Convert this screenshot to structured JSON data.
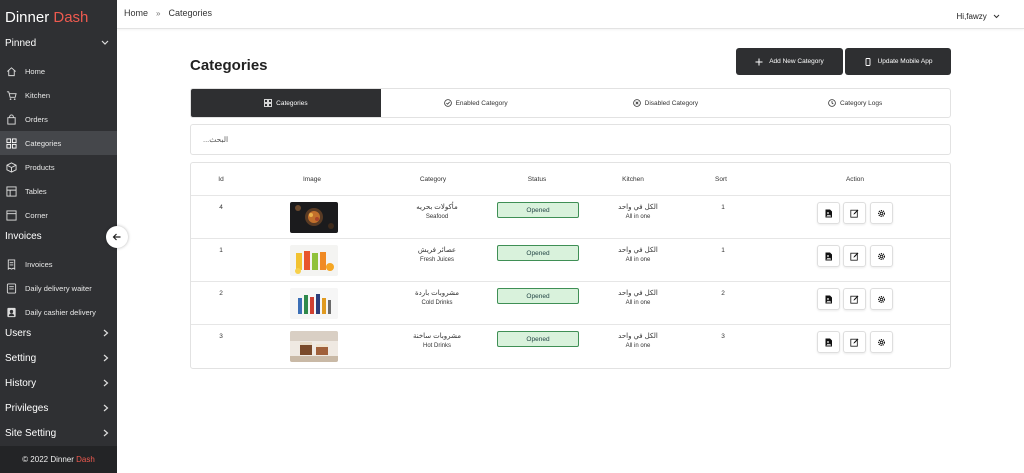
{
  "sidebar": {
    "brand_primary": "Dinner",
    "brand_accent": "Dash",
    "sections": [
      {
        "label": "Pinned",
        "chevron": "v"
      },
      {
        "label": "Invoices",
        "chevron": ""
      },
      {
        "label": "Users",
        "chevron": ">"
      },
      {
        "label": "Setting",
        "chevron": ">"
      },
      {
        "label": "History",
        "chevron": ">"
      },
      {
        "label": "Privileges",
        "chevron": ">"
      },
      {
        "label": "Site Setting",
        "chevron": ">"
      }
    ],
    "pinned_items": [
      {
        "label": "Home",
        "icon": "home-icon"
      },
      {
        "label": "Kitchen",
        "icon": "cart-icon"
      },
      {
        "label": "Orders",
        "icon": "bag-icon"
      },
      {
        "label": "Categories",
        "icon": "categories-icon",
        "active": true
      },
      {
        "label": "Products",
        "icon": "box-icon"
      },
      {
        "label": "Tables",
        "icon": "table-icon"
      },
      {
        "label": "Corner",
        "icon": "corner-icon"
      }
    ],
    "invoice_items": [
      {
        "label": "Invoices",
        "icon": "invoice-icon"
      },
      {
        "label": "Daily delivery waiter",
        "icon": "delivery-icon"
      },
      {
        "label": "Daily cashier delivery",
        "icon": "cashier-icon"
      }
    ],
    "footer_text": "© 2022 Dinner",
    "footer_accent": "Dash"
  },
  "topbar": {
    "breadcrumb": [
      "Home",
      "Categories"
    ],
    "breadcrumb_separator": "»",
    "user_greeting": "Hi,fawzy"
  },
  "main": {
    "page_title": "Categories",
    "add_button": "Add New Category",
    "update_button": "Update Mobile App",
    "tabs": [
      {
        "label": "Categories",
        "icon": "categories-icon",
        "active": true
      },
      {
        "label": "Enabled Category",
        "icon": "check-circle-icon"
      },
      {
        "label": "Disabled Category",
        "icon": "x-circle-icon"
      },
      {
        "label": "Category Logs",
        "icon": "history-icon"
      }
    ],
    "search_placeholder": "البحث..."
  },
  "table": {
    "columns": [
      "Id",
      "Image",
      "Category",
      "Status",
      "Kitchen",
      "Sort",
      "Action"
    ],
    "rows": [
      {
        "id": "4",
        "image": "seafood-image",
        "category_ar": "مأكولات بحريه",
        "category_en": "Seafood",
        "status": "Opened",
        "kitchen_ar": "الكل في واحد",
        "kitchen_en": "All in one",
        "sort": "1"
      },
      {
        "id": "1",
        "image": "juices-image",
        "category_ar": "عصائر فريش",
        "category_en": "Fresh Juices",
        "status": "Opened",
        "kitchen_ar": "الكل في واحد",
        "kitchen_en": "All in one",
        "sort": "1"
      },
      {
        "id": "2",
        "image": "cold-drinks-image",
        "category_ar": "مشروبات باردة",
        "category_en": "Cold Drinks",
        "status": "Opened",
        "kitchen_ar": "الكل في واحد",
        "kitchen_en": "All in one",
        "sort": "2"
      },
      {
        "id": "3",
        "image": "hot-drinks-image",
        "category_ar": "مشروبات ساخنة",
        "category_en": "Hot Drinks",
        "status": "Opened",
        "kitchen_ar": "الكل في واحد",
        "kitchen_en": "All in one",
        "sort": "3"
      }
    ]
  },
  "colors": {
    "sidebar_bg": "#2f3033",
    "brand_accent": "#ee5a4f",
    "dark_button": "#2e2f31",
    "status_bg": "#d9f2dc",
    "status_border": "#3f8f55"
  }
}
